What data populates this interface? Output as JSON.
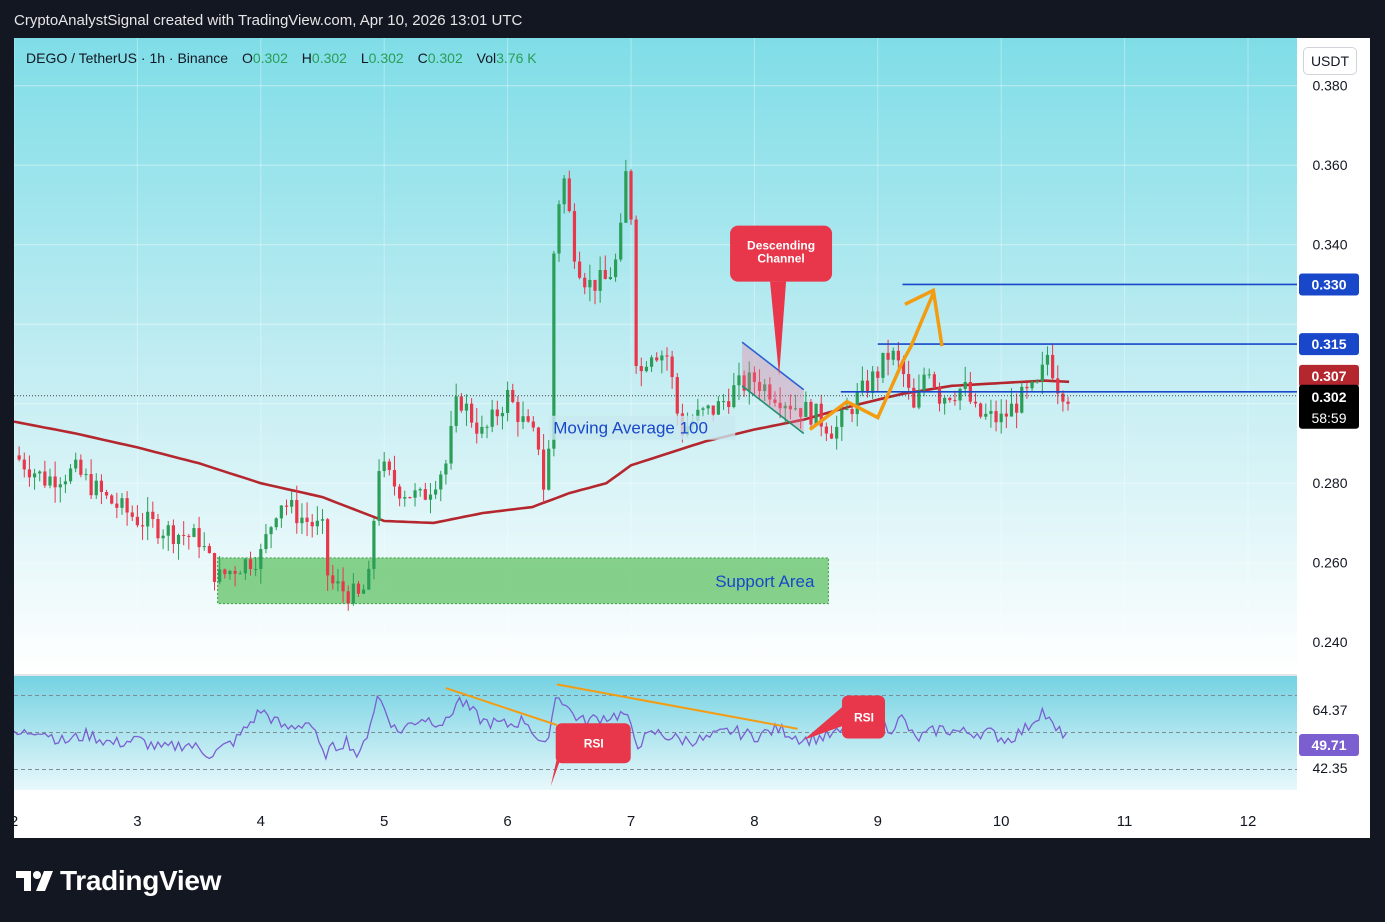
{
  "header": {
    "attribution": "CryptoAnalystSignal created with TradingView.com, Apr 10, 2026 13:01 UTC"
  },
  "symbol_bar": {
    "symbol": "DEGO / TetherUS · 1h · Binance",
    "o_label": "O",
    "o_value": "0.302",
    "h_label": "H",
    "h_value": "0.302",
    "l_label": "L",
    "l_value": "0.302",
    "c_label": "C",
    "c_value": "0.302",
    "vol_label": "Vol",
    "vol_value": "3.76 K"
  },
  "currency": "USDT",
  "brand": {
    "name": "TradingView"
  },
  "colors": {
    "up": "#2a9d57",
    "down": "#e8364a",
    "ma": "#b5272e",
    "level_line": "#1848c9",
    "support": "#5cbf5f",
    "rsi": "#7b5fd0",
    "trend": "#f39c12",
    "callout": "#e8364a"
  },
  "annotations": {
    "descending_channel": "Descending\nChannel",
    "moving_average": "Moving Average 100",
    "support_area": "Support Area",
    "rsi_callout_1": "RSI",
    "rsi_callout_2": "RSI"
  },
  "chart_data": {
    "type": "candlestick",
    "title": "DEGO / TetherUS · 1h · Binance",
    "x_tick_labels": [
      "2",
      "3",
      "4",
      "5",
      "6",
      "7",
      "8",
      "9",
      "10",
      "11",
      "12"
    ],
    "x_range_days": [
      2,
      12.45
    ],
    "last_bar_day": 10.55,
    "ylim": [
      0.232,
      0.392
    ],
    "y_ticks": [
      0.24,
      0.26,
      0.28,
      0.3,
      0.32,
      0.34,
      0.36,
      0.38
    ],
    "y_tick_labels": [
      "0.240",
      "0.260",
      "0.280",
      "",
      "",
      "0.340",
      "0.360",
      "0.380"
    ],
    "price_close_path": [
      [
        2.0,
        0.287
      ],
      [
        2.25,
        0.281
      ],
      [
        2.5,
        0.283
      ],
      [
        2.75,
        0.276
      ],
      [
        3.0,
        0.271
      ],
      [
        3.25,
        0.268
      ],
      [
        3.5,
        0.266
      ],
      [
        3.65,
        0.256
      ],
      [
        3.8,
        0.259
      ],
      [
        4.0,
        0.262
      ],
      [
        4.15,
        0.276
      ],
      [
        4.3,
        0.272
      ],
      [
        4.5,
        0.268
      ],
      [
        4.55,
        0.255
      ],
      [
        4.8,
        0.251
      ],
      [
        4.88,
        0.256
      ],
      [
        4.95,
        0.285
      ],
      [
        5.1,
        0.279
      ],
      [
        5.3,
        0.276
      ],
      [
        5.5,
        0.285
      ],
      [
        5.6,
        0.302
      ],
      [
        5.8,
        0.292
      ],
      [
        6.0,
        0.302
      ],
      [
        6.15,
        0.294
      ],
      [
        6.25,
        0.29
      ],
      [
        6.32,
        0.272
      ],
      [
        6.38,
        0.344
      ],
      [
        6.45,
        0.358
      ],
      [
        6.55,
        0.337
      ],
      [
        6.65,
        0.33
      ],
      [
        6.8,
        0.331
      ],
      [
        6.9,
        0.337
      ],
      [
        6.98,
        0.365
      ],
      [
        7.05,
        0.305
      ],
      [
        7.15,
        0.314
      ],
      [
        7.3,
        0.312
      ],
      [
        7.4,
        0.293
      ],
      [
        7.55,
        0.297
      ],
      [
        7.7,
        0.299
      ],
      [
        7.85,
        0.304
      ],
      [
        8.0,
        0.306
      ],
      [
        8.15,
        0.303
      ],
      [
        8.3,
        0.3
      ],
      [
        8.5,
        0.297
      ],
      [
        8.65,
        0.293
      ],
      [
        8.8,
        0.3
      ],
      [
        9.0,
        0.308
      ],
      [
        9.1,
        0.313
      ],
      [
        9.2,
        0.308
      ],
      [
        9.3,
        0.297
      ],
      [
        9.4,
        0.311
      ],
      [
        9.5,
        0.302
      ],
      [
        9.7,
        0.304
      ],
      [
        9.8,
        0.297
      ],
      [
        10.0,
        0.296
      ],
      [
        10.15,
        0.301
      ],
      [
        10.3,
        0.304
      ],
      [
        10.38,
        0.313
      ],
      [
        10.45,
        0.305
      ],
      [
        10.55,
        0.302
      ]
    ],
    "ma100_path": [
      [
        2.0,
        0.2955
      ],
      [
        2.5,
        0.2925
      ],
      [
        3.0,
        0.289
      ],
      [
        3.5,
        0.285
      ],
      [
        4.0,
        0.28
      ],
      [
        4.5,
        0.2765
      ],
      [
        4.75,
        0.2735
      ],
      [
        5.0,
        0.2705
      ],
      [
        5.4,
        0.27
      ],
      [
        5.8,
        0.2725
      ],
      [
        6.2,
        0.274
      ],
      [
        6.5,
        0.2775
      ],
      [
        6.8,
        0.28
      ],
      [
        7.0,
        0.2845
      ],
      [
        7.3,
        0.2875
      ],
      [
        7.6,
        0.2905
      ],
      [
        8.0,
        0.2935
      ],
      [
        8.4,
        0.296
      ],
      [
        8.8,
        0.2995
      ],
      [
        9.2,
        0.3025
      ],
      [
        9.6,
        0.3045
      ],
      [
        10.0,
        0.3052
      ],
      [
        10.35,
        0.3058
      ],
      [
        10.55,
        0.3055
      ]
    ],
    "moving_average_name": "Moving Average 100",
    "price_levels": [
      {
        "label": "0.330",
        "value": 0.33,
        "from_day": 9.2
      },
      {
        "label": "0.315",
        "value": 0.315,
        "from_day": 9.0
      },
      {
        "label": "0.303",
        "value": 0.303,
        "from_day": 8.7
      }
    ],
    "last_price": {
      "label": "0.302",
      "value": 0.302,
      "countdown": "58:59"
    },
    "ma_value": {
      "label": "0.307",
      "value": 0.307
    },
    "support_area": {
      "label": "Support Area",
      "day_from": 3.65,
      "day_to": 8.6,
      "low": 0.2497,
      "high": 0.2612
    },
    "descending_channel": {
      "label": "Descending\nChannel",
      "day_from": 7.9,
      "day_to": 8.4
    },
    "rsi": {
      "ylim": [
        20,
        80
      ],
      "upper_band": 70,
      "mid_band": 50,
      "lower_band": 30,
      "axis_labels": [
        "64.37",
        "42.35"
      ],
      "current": "49.71",
      "path": [
        [
          2.0,
          48
        ],
        [
          2.2,
          52
        ],
        [
          2.4,
          45
        ],
        [
          2.6,
          49
        ],
        [
          2.8,
          44
        ],
        [
          3.0,
          46
        ],
        [
          3.2,
          41
        ],
        [
          3.4,
          44
        ],
        [
          3.6,
          38
        ],
        [
          3.8,
          46
        ],
        [
          4.0,
          62
        ],
        [
          4.2,
          52
        ],
        [
          4.4,
          56
        ],
        [
          4.5,
          38
        ],
        [
          4.7,
          46
        ],
        [
          4.8,
          36
        ],
        [
          4.95,
          70
        ],
        [
          5.1,
          50
        ],
        [
          5.3,
          58
        ],
        [
          5.5,
          55
        ],
        [
          5.6,
          68
        ],
        [
          5.8,
          56
        ],
        [
          6.0,
          54
        ],
        [
          6.15,
          57
        ],
        [
          6.3,
          40
        ],
        [
          6.4,
          72
        ],
        [
          6.5,
          62
        ],
        [
          6.6,
          56
        ],
        [
          6.75,
          58
        ],
        [
          6.95,
          60
        ],
        [
          7.05,
          44
        ],
        [
          7.2,
          50
        ],
        [
          7.4,
          46
        ],
        [
          7.6,
          46
        ],
        [
          7.8,
          51
        ],
        [
          8.0,
          48
        ],
        [
          8.2,
          52
        ],
        [
          8.4,
          46
        ],
        [
          8.6,
          48
        ],
        [
          8.8,
          52
        ],
        [
          8.9,
          60
        ],
        [
          9.1,
          52
        ],
        [
          9.2,
          58
        ],
        [
          9.3,
          46
        ],
        [
          9.5,
          52
        ],
        [
          9.7,
          50
        ],
        [
          9.9,
          50
        ],
        [
          10.05,
          46
        ],
        [
          10.2,
          52
        ],
        [
          10.33,
          62
        ],
        [
          10.45,
          50
        ],
        [
          10.55,
          49.7
        ]
      ]
    }
  }
}
